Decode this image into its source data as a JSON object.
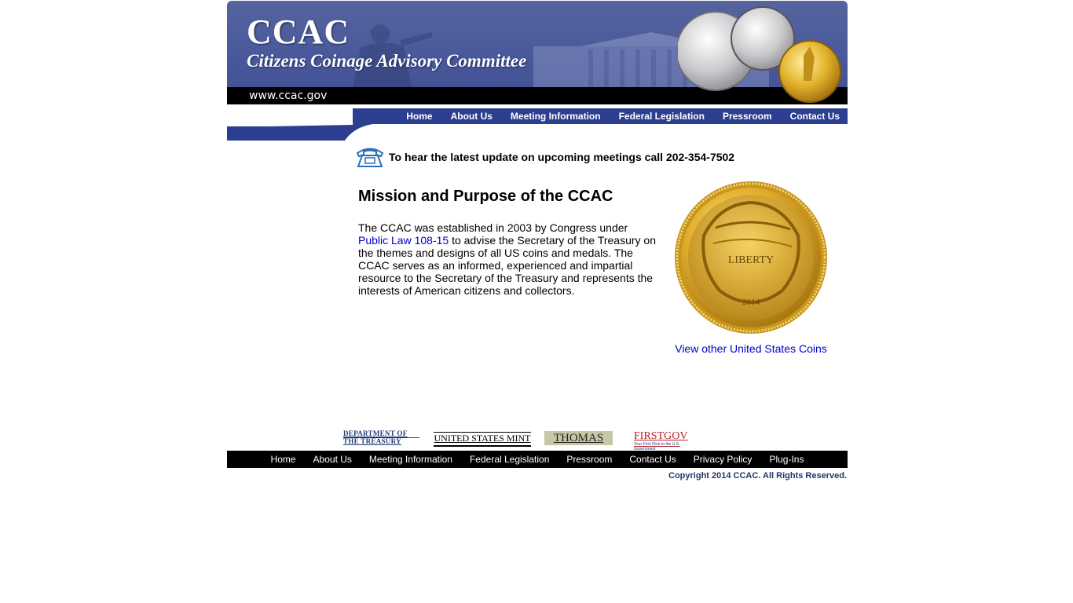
{
  "header": {
    "title": "CCAC",
    "subtitle": "Citizens Coinage Advisory Committee",
    "url": "www.ccac.gov"
  },
  "nav": {
    "items": [
      "Home",
      "About Us",
      "Meeting Information",
      "Federal Legislation",
      "Pressroom",
      "Contact Us"
    ]
  },
  "phone": {
    "text": "To hear the latest update on upcoming meetings call 202-354-7502",
    "icon": "telephone-icon"
  },
  "mission": {
    "heading": "Mission and Purpose of the CCAC",
    "text_before": "The CCAC was established in 2003 by Congress under ",
    "link": "Public Law 108-15",
    "text_after": " to advise the Secretary of the Treasury on the themes and designs of all US coins and medals. The CCAC serves as an informed, experienced and impartial resource to the Secretary of the Treasury and represents the interests of American citizens and collectors."
  },
  "coin": {
    "inscription": "LIBERTY",
    "year": "2014",
    "link": "View other United States Coins"
  },
  "partners": {
    "treasury_line1": "DEPARTMENT OF",
    "treasury_line2": "THE TREASURY",
    "mint": "UNITED STATES MINT",
    "thomas": "THOMAS",
    "firstgov": "FIRSTGOV",
    "firstgov_tagline": "Your First Click to the U.S. Government"
  },
  "footer": {
    "items": [
      "Home",
      "About Us",
      "Meeting Information",
      "Federal Legislation",
      "Pressroom",
      "Contact Us",
      "Privacy Policy",
      "Plug-Ins"
    ],
    "copyright": "Copyright 2014 CCAC. All Rights Reserved."
  },
  "colors": {
    "banner_blue": "#47579a",
    "nav_blue": "#2c3e8f",
    "link_blue": "#0000cc",
    "footer_black": "#000000",
    "gold": "#d9a423"
  }
}
